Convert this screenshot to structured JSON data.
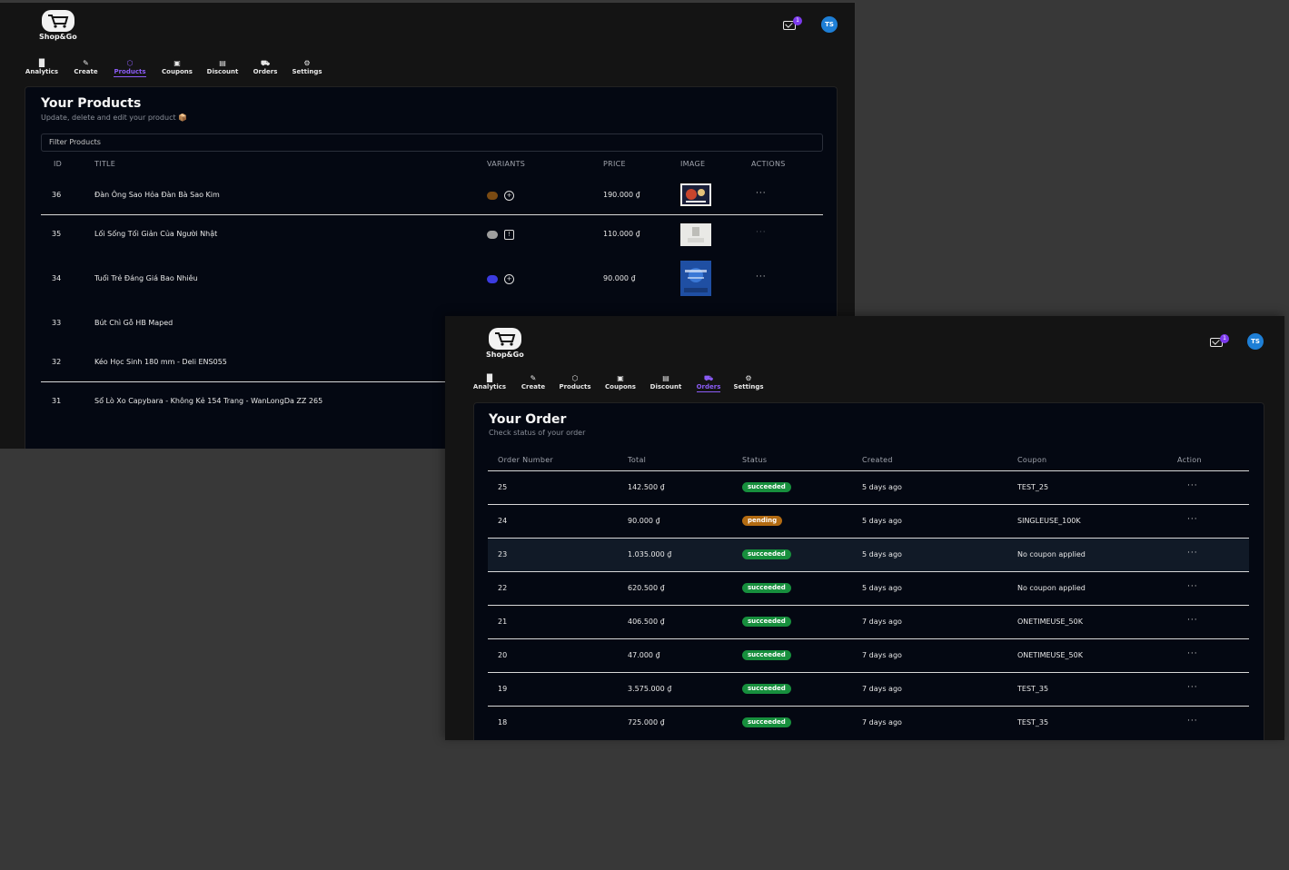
{
  "brand": {
    "name": "Shop&Go"
  },
  "header": {
    "mail_count": "1",
    "avatar_initials": "TS"
  },
  "nav": [
    {
      "label": "Analytics",
      "icon": "bar-chart-icon"
    },
    {
      "label": "Create",
      "icon": "edit-icon"
    },
    {
      "label": "Products",
      "icon": "box-icon"
    },
    {
      "label": "Coupons",
      "icon": "ticket-icon"
    },
    {
      "label": "Discount",
      "icon": "discount-ticket-icon"
    },
    {
      "label": "Orders",
      "icon": "truck-icon"
    },
    {
      "label": "Settings",
      "icon": "gear-icon"
    }
  ],
  "products_window": {
    "active_tab": "Products",
    "title": "Your Products",
    "subtitle": "Update, delete and edit your product 📦",
    "filter_placeholder": "Filter Products",
    "columns": [
      "ID",
      "TITLE",
      "VARIANTS",
      "PRICE",
      "IMAGE",
      "ACTIONS"
    ],
    "rows": [
      {
        "id": "36",
        "title": "Đàn Ông Sao Hỏa Đàn Bà Sao Kim",
        "variant_color": "#7a4a12",
        "price": "190.000 ₫",
        "actions": "···"
      },
      {
        "id": "35",
        "title": "Lối Sống Tối Giản Của Người Nhật",
        "variant_color": "#9e9e9e",
        "price": "110.000 ₫",
        "actions": "···"
      },
      {
        "id": "34",
        "title": "Tuổi Trẻ Đáng Giá Bao Nhiêu",
        "variant_color": "#3b3be0",
        "price": "90.000 ₫",
        "actions": "···"
      },
      {
        "id": "33",
        "title": "Bút Chì Gỗ HB Maped"
      },
      {
        "id": "32",
        "title": "Kéo Học Sinh 180 mm - Deli ENS055"
      },
      {
        "id": "31",
        "title": "Sổ Lò Xo Capybara - Không Kẻ 154 Trang - WanLongDa ZZ 265"
      }
    ]
  },
  "orders_window": {
    "active_tab": "Orders",
    "title": "Your Order",
    "subtitle": "Check status of your order",
    "columns": [
      "Order Number",
      "Total",
      "Status",
      "Created",
      "Coupon",
      "Action"
    ],
    "rows": [
      {
        "number": "25",
        "total": "142.500 ₫",
        "status": "succeeded",
        "created": "5 days ago",
        "coupon": "TEST_25",
        "action": "···"
      },
      {
        "number": "24",
        "total": "90.000 ₫",
        "status": "pending",
        "created": "5 days ago",
        "coupon": "SINGLEUSE_100K",
        "action": "···"
      },
      {
        "number": "23",
        "total": "1.035.000 ₫",
        "status": "succeeded",
        "created": "5 days ago",
        "coupon": "No coupon applied",
        "action": "···"
      },
      {
        "number": "22",
        "total": "620.500 ₫",
        "status": "succeeded",
        "created": "5 days ago",
        "coupon": "No coupon applied",
        "action": "···"
      },
      {
        "number": "21",
        "total": "406.500 ₫",
        "status": "succeeded",
        "created": "7 days ago",
        "coupon": "ONETIMEUSE_50K",
        "action": "···"
      },
      {
        "number": "20",
        "total": "47.000 ₫",
        "status": "succeeded",
        "created": "7 days ago",
        "coupon": "ONETIMEUSE_50K",
        "action": "···"
      },
      {
        "number": "19",
        "total": "3.575.000 ₫",
        "status": "succeeded",
        "created": "7 days ago",
        "coupon": "TEST_35",
        "action": "···"
      },
      {
        "number": "18",
        "total": "725.000 ₫",
        "status": "succeeded",
        "created": "7 days ago",
        "coupon": "TEST_35",
        "action": "···"
      }
    ]
  }
}
